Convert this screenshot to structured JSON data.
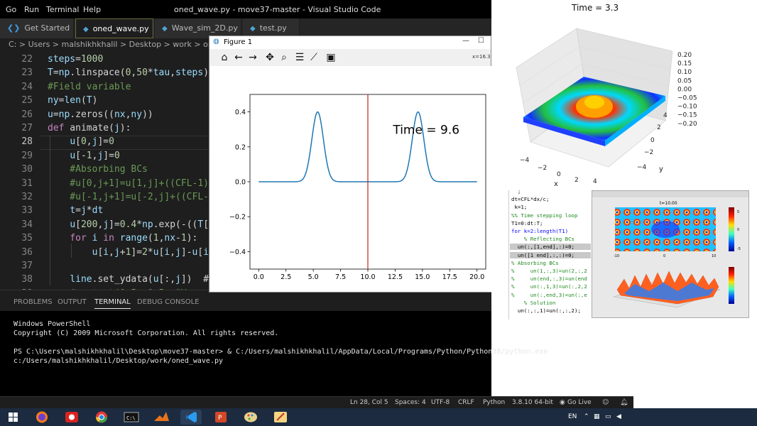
{
  "menu": [
    "Go",
    "Run",
    "Terminal",
    "Help"
  ],
  "window_title": "oned_wave.py - move37-master - Visual Studio Code",
  "tabs": [
    {
      "label": "Get Started",
      "active": false
    },
    {
      "label": "oned_wave.py",
      "active": true
    },
    {
      "label": "Wave_sim_2D.py",
      "active": false
    },
    {
      "label": "test.py",
      "active": false
    }
  ],
  "breadcrumb": "C: > Users > malshikhkhalil > Desktop > work > oned_w",
  "code_lines": [
    {
      "num": "22",
      "text": "steps=1000"
    },
    {
      "num": "23",
      "text": "T=np.linspace(0,50*tau,steps)"
    },
    {
      "num": "24",
      "text": "#Field variable"
    },
    {
      "num": "25",
      "text": "ny=len(T)"
    },
    {
      "num": "26",
      "text": "u=np.zeros((nx,ny))"
    },
    {
      "num": "27",
      "text": "def animate(j):"
    },
    {
      "num": "28",
      "text": "    u[0,j]=0"
    },
    {
      "num": "29",
      "text": "    u[-1,j]=0"
    },
    {
      "num": "30",
      "text": "    #Absorbing BCs"
    },
    {
      "num": "31",
      "text": "    #u[0,j+1]=u[1,j]+((CFL-1)"
    },
    {
      "num": "32",
      "text": "    #u[-1,j+1]=u[-2,j]+((CFL-"
    },
    {
      "num": "33",
      "text": "    t=j*dt"
    },
    {
      "num": "34",
      "text": "    u[200,j]=0.4*np.exp(-((T["
    },
    {
      "num": "35",
      "text": "    for i in range(1,nx-1):"
    },
    {
      "num": "36",
      "text": "        u[i,j+1]=2*u[i,j]-u[i"
    },
    {
      "num": "37",
      "text": ""
    },
    {
      "num": "38",
      "text": "    line.set_ydata(u[:,j])  #"
    },
    {
      "num": "39",
      "text": "    #ax.text(0.5, 0.5, \"Ye"
    }
  ],
  "panel_tabs": [
    "PROBLEMS",
    "OUTPUT",
    "TERMINAL",
    "DEBUG CONSOLE"
  ],
  "terminal_lines": [
    "Windows PowerShell",
    "Copyright (C) 2009 Microsoft Corporation. All rights reserved.",
    "",
    "PS C:\\Users\\malshikhkhalil\\Desktop\\move37-master> & C:/Users/malshikhkhalil/AppData/Local/Programs/Python/Python38/python.exe",
    "c:/Users/malshikhkhalil/Desktop/work/oned_wave.py"
  ],
  "status": {
    "position": "Ln 28, Col 5",
    "spaces": "Spaces: 4",
    "encoding": "UTF-8",
    "eol": "CRLF",
    "language": "Python",
    "version": "3.8.10 64-bit",
    "golive": "Go Live"
  },
  "figure_window": {
    "title": "Figure 1",
    "coord_text": "x=16.3",
    "toolbar_icons": [
      "home-icon",
      "back-icon",
      "forward-icon",
      "pan-icon",
      "zoom-icon",
      "configure-icon",
      "edit-axis-icon",
      "save-icon"
    ]
  },
  "chart_data": [
    {
      "type": "line",
      "annotation": "Time = 9.6",
      "x_ticks": [
        "0.0",
        "2.5",
        "5.0",
        "7.5",
        "10.0",
        "12.5",
        "15.0",
        "17.5",
        "20.0"
      ],
      "y_ticks": [
        "0.4",
        "0.2",
        "0.0",
        "−0.2",
        "−0.4"
      ],
      "xlim": [
        -0.8,
        20.8
      ],
      "ylim": [
        -0.5,
        0.5
      ],
      "vline_x": 10.0,
      "vline_color": "#c0392b",
      "line_color": "#1f77b4",
      "series": [
        {
          "gaussians": [
            {
              "center": 5.4,
              "amp": 0.4,
              "width": 0.75
            },
            {
              "center": 14.6,
              "amp": 0.4,
              "width": 0.75
            }
          ]
        }
      ]
    },
    {
      "type": "surface",
      "title": "Time = 3.3",
      "z_ticks": [
        "0.20",
        "0.15",
        "0.10",
        "0.05",
        "0.00",
        "−0.05",
        "−0.10",
        "−0.15",
        "−0.20"
      ],
      "x_ticks": [
        "−4",
        "−2",
        "0",
        "2",
        "4"
      ],
      "y_ticks": [
        "−4",
        "−2",
        "0",
        "2",
        "4"
      ],
      "xlabel": "x",
      "ylabel": "y"
    }
  ],
  "matlab_code": [
    {
      "text": "  ;",
      "kind": "n"
    },
    {
      "text": "dt=CFL*dx/c;",
      "kind": "n"
    },
    {
      "text": " k=1;",
      "kind": "n"
    },
    {
      "text": "%% Time stepping loop",
      "kind": "c"
    },
    {
      "text": "T1=0:dt:T;",
      "kind": "n"
    },
    {
      "text": "for k=2:length(T1)",
      "kind": "k"
    },
    {
      "text": "    % Reflecting BCs",
      "kind": "c"
    },
    {
      "text": "  un(:,[1,end],:)=0;",
      "kind": "hl"
    },
    {
      "text": "  un([1 end],:,:)=0;",
      "kind": "hl"
    },
    {
      "text": "% Absorbing BCs",
      "kind": "c"
    },
    {
      "text": "%     un(1,:,3)=un(2,:,2",
      "kind": "c"
    },
    {
      "text": "%     un(end,:,3)=un(end",
      "kind": "c"
    },
    {
      "text": "%     un(:,1,3)=un(:,2,2",
      "kind": "c"
    },
    {
      "text": "%     un(:,end,3)=un(:,e",
      "kind": "c"
    },
    {
      "text": "    % Solution",
      "kind": "c"
    },
    {
      "text": "  un(:,:,1)=un(:,:,2);",
      "kind": "n"
    }
  ],
  "matlab_fig": {
    "title": "t=10.00",
    "cbar_top": "5",
    "cbar_mid": "0",
    "cbar_bot": "-5",
    "xticks": [
      "-10",
      "0",
      "10"
    ]
  },
  "taskbar": {
    "lang": "EN",
    "icons": [
      "windows-start",
      "firefox",
      "cisco",
      "chrome",
      "cmd",
      "matlab",
      "vscode",
      "powerpoint",
      "paint",
      "tool"
    ]
  }
}
